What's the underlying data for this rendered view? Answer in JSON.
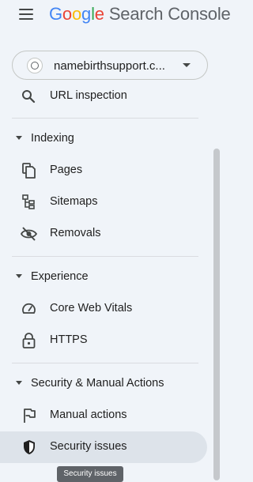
{
  "app": {
    "brand_letters": [
      "G",
      "o",
      "o",
      "g",
      "l",
      "e"
    ],
    "product_name": "Search Console"
  },
  "property": {
    "name": "namebirthsupport.c..."
  },
  "nav": {
    "url_inspection": "URL inspection",
    "sections": [
      {
        "title": "Indexing",
        "items": [
          {
            "label": "Pages",
            "icon": "pages-icon"
          },
          {
            "label": "Sitemaps",
            "icon": "sitemaps-icon"
          },
          {
            "label": "Removals",
            "icon": "removals-icon"
          }
        ]
      },
      {
        "title": "Experience",
        "items": [
          {
            "label": "Core Web Vitals",
            "icon": "speedometer-icon"
          },
          {
            "label": "HTTPS",
            "icon": "lock-icon"
          }
        ]
      },
      {
        "title": "Security & Manual Actions",
        "items": [
          {
            "label": "Manual actions",
            "icon": "flag-icon"
          },
          {
            "label": "Security issues",
            "icon": "shield-icon",
            "selected": true
          }
        ]
      }
    ]
  },
  "tooltip": {
    "text": "Security issues"
  },
  "colors": {
    "background": "#f0f4f9",
    "selected_bg": "#dde3ea",
    "google_blue": "#4285f4",
    "google_red": "#ea4335",
    "google_yellow": "#fbbc05",
    "google_green": "#34a853"
  }
}
